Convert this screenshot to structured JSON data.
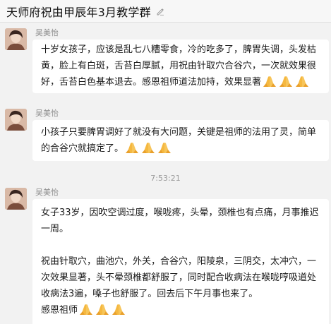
{
  "header": {
    "title": "天师府祝由甲辰年3月教学群",
    "edit_icon": "pencil-edit-icon"
  },
  "messages": [
    {
      "sender": "吴美怡",
      "lines": [
        "十岁女孩子，应该是乱七八糟零食，冷的吃多了，脾胃失调，头发枯黄，脸上有白斑，舌苔白厚腻，用祝由针取穴合谷穴，一次就效果很好，舌苔白色基本退去。感恩祖师道法加持，效果显著"
      ],
      "emoji": "praying-hands-icon",
      "emoji_count": 3
    },
    {
      "sender": "吴美怡",
      "lines": [
        "小孩子只要脾胃调好了就没有大问题，关键是祖师的法用了灵，简单的合谷穴就搞定了。"
      ],
      "emoji": "praying-hands-icon",
      "emoji_count": 3
    },
    {
      "timestamp": "7:53:21"
    },
    {
      "sender": "吴美怡",
      "paragraph1": "女子33岁，因吹空调过度，喉咙疼，头晕，颈椎也有点痛，月事推迟一周。",
      "paragraph2": "祝由针取穴，曲池穴，外关，合谷穴，阳陵泉，三阴交，太冲穴，一次效果显著，头不晕颈椎都舒服了，同时配合收病法在喉咙哼吸道处收病法3遍，嗓子也舒服了。回去后下午月事也来了。",
      "paragraph3": "感恩祖师",
      "emoji": "praying-hands-icon",
      "emoji_count": 3
    }
  ],
  "colors": {
    "background": "#f2f2f2",
    "bubble": "#ffffff",
    "sender": "#8c8c8c",
    "emoji": "#f5b840"
  }
}
